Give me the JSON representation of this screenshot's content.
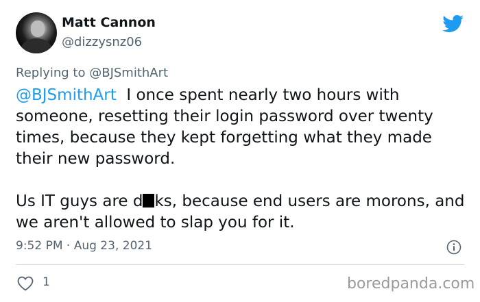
{
  "author": {
    "display_name": "Matt Cannon",
    "handle": "@dizzysnz06",
    "avatar_icon": "profile-photo"
  },
  "brand": {
    "icon": "twitter-bird-icon",
    "color": "#1d9bf0"
  },
  "reply": {
    "prefix": "Replying to",
    "mention": "@BJSmithArt"
  },
  "tweet": {
    "mention": "@BJSmithArt",
    "paragraph1_text": "I once spent nearly two hours with someone, resetting their login password over twenty times, because they kept forgetting what they made their new password.",
    "paragraph2_before": "Us IT guys are d",
    "paragraph2_after": "ks, because end users are morons, and we aren't allowed to slap you for it.",
    "timestamp": "9:52 PM · Aug 23, 2021"
  },
  "actions": {
    "like_count": "1",
    "like_icon": "heart-icon",
    "info_icon": "info-icon"
  },
  "watermark": "boredpanda.com",
  "colors": {
    "text": "#0f1419",
    "secondary": "#536471",
    "link": "#1d9bf0",
    "divider": "#cfd9de"
  }
}
